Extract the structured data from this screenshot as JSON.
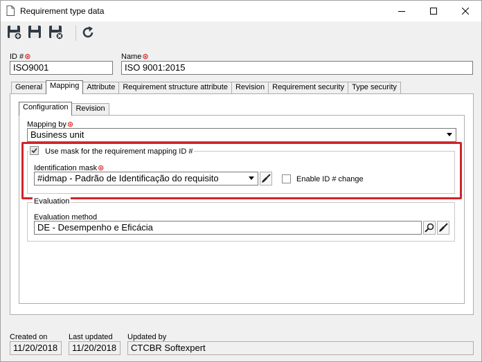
{
  "window": {
    "title": "Requirement type data"
  },
  "toolbar": {
    "buttons": [
      {
        "name": "save-new-icon"
      },
      {
        "name": "save-icon"
      },
      {
        "name": "save-close-icon"
      },
      {
        "name": "refresh-icon"
      }
    ]
  },
  "id": {
    "label": "ID #",
    "value": "ISO9001"
  },
  "name": {
    "label": "Name",
    "value": "ISO 9001:2015"
  },
  "tabs": [
    "General",
    "Mapping",
    "Attribute",
    "Requirement structure attribute",
    "Revision",
    "Requirement security",
    "Type security"
  ],
  "subtabs": [
    "Configuration",
    "Revision"
  ],
  "mapping": {
    "mapping_by_label": "Mapping by",
    "mapping_by_value": "Business unit",
    "use_mask_label": "Use mask for the requirement mapping ID #",
    "id_mask_label": "Identification mask",
    "id_mask_value": "#idmap - Padrão de Identificação do requisito",
    "enable_id_change_label": "Enable ID # change",
    "evaluation_group_label": "Evaluation",
    "evaluation_method_label": "Evaluation method",
    "evaluation_method_value": "DE - Desempenho e Eficácia"
  },
  "footer": {
    "created_on_label": "Created on",
    "created_on_value": "11/20/2018",
    "last_updated_label": "Last updated",
    "last_updated_value": "11/20/2018",
    "updated_by_label": "Updated by",
    "updated_by_value": "CTCBR Softexpert"
  },
  "colors": {
    "highlight": "#d2232a",
    "required": "#d40000"
  }
}
